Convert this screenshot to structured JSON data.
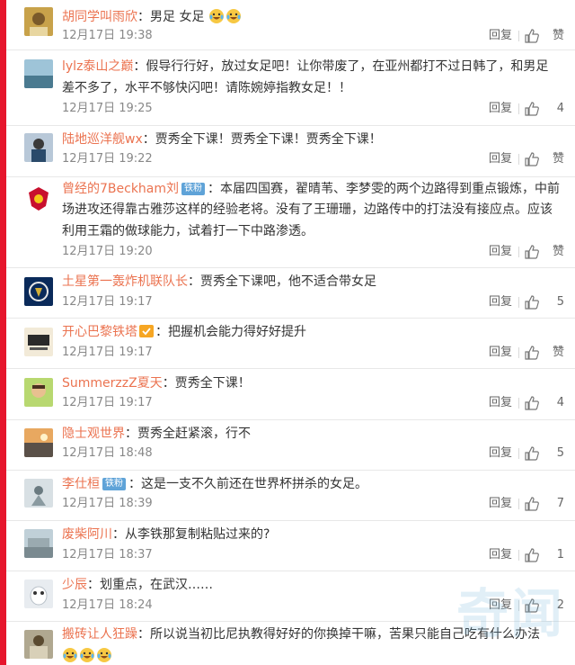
{
  "colors": {
    "username": "#eb7350",
    "accent_bar": "#e6162d",
    "fan_badge": "#5fa3d8"
  },
  "reply_label": "回复",
  "comments": [
    {
      "username": "胡同学叫雨欣",
      "badge": "",
      "text": "男足 女足",
      "text_cont": "",
      "emojis_after": 2,
      "time": "12月17日 19:38",
      "like": "赞"
    },
    {
      "username": "lylz泰山之巅",
      "badge": "",
      "text": "假导行行好，放过女足吧！让你带废了，在亚州都打不过日韩了，和男足",
      "text_cont": "差不多了，水平不够快闪吧！请陈婉婷指教女足！！",
      "emojis_after": 0,
      "time": "12月17日 19:25",
      "like": "4"
    },
    {
      "username": "陆地巡洋舰wx",
      "badge": "",
      "text": "贾秀全下课！贾秀全下课！贾秀全下课！",
      "text_cont": "",
      "emojis_after": 0,
      "time": "12月17日 19:22",
      "like": "赞"
    },
    {
      "username": "曾经的7Beckham刘",
      "badge": "铁粉",
      "text": "本届四国赛，翟晴苇、李梦雯的两个边路得到重点锻炼，中前",
      "text_cont": "场进攻还得靠古雅莎这样的经验老将。没有了王珊珊，边路传中的打法没有接应点。应该",
      "text_cont2": "利用王霜的做球能力，试着打一下中路渗透。",
      "emojis_after": 0,
      "time": "12月17日 19:20",
      "like": "赞"
    },
    {
      "username": "土星第一轰炸机联队长",
      "badge": "",
      "text": "贾秀全下课吧，他不适合带女足",
      "text_cont": "",
      "emojis_after": 0,
      "time": "12月17日 19:17",
      "like": "5"
    },
    {
      "username": "开心巴黎铁塔",
      "badge": "fan-icon",
      "text": "把握机会能力得好好提升",
      "text_cont": "",
      "emojis_after": 0,
      "time": "12月17日 19:17",
      "like": "赞"
    },
    {
      "username": "SummerzzZ夏天",
      "badge": "",
      "text": "贾秀全下课！",
      "text_cont": "",
      "emojis_after": 0,
      "time": "12月17日 19:17",
      "like": "4"
    },
    {
      "username": "隐士观世界",
      "badge": "",
      "text": "贾秀全赶紧滚，行不",
      "text_cont": "",
      "emojis_after": 0,
      "time": "12月17日 18:48",
      "like": "5"
    },
    {
      "username": "李仕桓",
      "badge": "铁粉",
      "text": "这是一支不久前还在世界杯拼杀的女足。",
      "text_cont": "",
      "emojis_after": 0,
      "time": "12月17日 18:39",
      "like": "7"
    },
    {
      "username": "废柴阿川",
      "badge": "",
      "text": "从李铁那复制粘贴过来的?",
      "text_cont": "",
      "emojis_after": 0,
      "time": "12月17日 18:37",
      "like": "1"
    },
    {
      "username": "少辰",
      "badge": "",
      "text": "划重点，在武汉……",
      "text_cont": "",
      "emojis_after": 0,
      "time": "12月17日 18:24",
      "like": "2"
    },
    {
      "username": "搬砖让人狂躁",
      "badge": "",
      "text": "所以说当初比尼执教得好好的你换掉干嘛，苦果只能自己吃有什么办法",
      "text_cont": "",
      "emojis_line2": 3,
      "time": "",
      "like": ""
    }
  ],
  "watermark": "奇闻"
}
